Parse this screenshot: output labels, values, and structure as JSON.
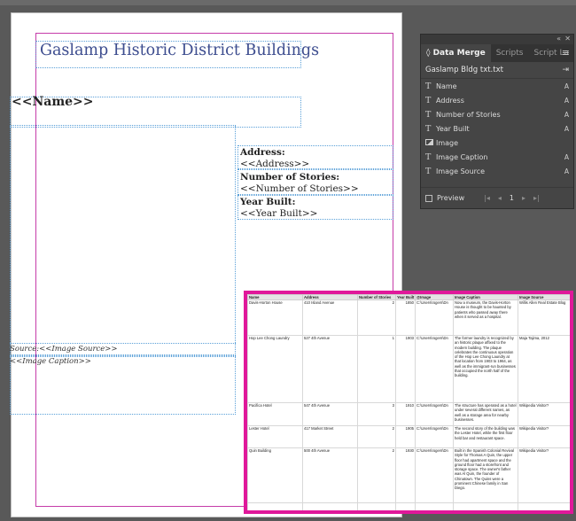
{
  "layout_page": {
    "title": "Gaslamp Historic District Buildings",
    "name_placeholder": "<<Name>>",
    "address_label": "Address:",
    "address_value": "<<Address>>",
    "stories_label": "Number of Stories:",
    "stories_value": "<<Number of Stories>>",
    "year_label": "Year Built:",
    "year_value": "<<Year Built>>",
    "source_text": "Source:<<Image Source>>",
    "caption_text": "<<Image Caption>>"
  },
  "panel": {
    "collapse_glyph": "«",
    "close_glyph": "✕",
    "tabs": [
      {
        "label": "◊ Data Merge"
      },
      {
        "label": "Scripts"
      },
      {
        "label": "Script La"
      }
    ],
    "menu_glyph": "≡",
    "source_file": "Gaslamp Bldg txt.txt",
    "fields": [
      {
        "label": "Name",
        "suffix": "A"
      },
      {
        "label": "Address",
        "suffix": "A"
      },
      {
        "label": "Number of Stories",
        "suffix": "A"
      },
      {
        "label": "Year Built",
        "suffix": "A"
      },
      {
        "label": "Image",
        "suffix": ""
      },
      {
        "label": "Image Caption",
        "suffix": "A"
      },
      {
        "label": "Image Source",
        "suffix": "A"
      }
    ],
    "preview_label": "Preview",
    "record_number": "1",
    "nav_first": "|◂",
    "nav_prev": "◂",
    "nav_next": "▸",
    "nav_last": "▸|"
  },
  "spreadsheet": {
    "headers": [
      "Name",
      "Address",
      "Number of Stories",
      "Year Built",
      "@Image",
      "Image Caption",
      "Image Source"
    ],
    "rows": [
      [
        "Davis-Horton House",
        "410 Island Avenue",
        "2",
        "1850",
        "C:\\Users\\rogers\\Dn",
        "Now a museum, the Davis-Horton House is thought to be haunted by patients who passed away there when it served as a hospital.",
        "Willis Allen Real Estate Blog"
      ],
      [
        "Hop Lee Chong Laundry",
        "527 4th Avenue",
        "1",
        "1903",
        "C:\\Users\\rogers\\Dn",
        "The former laundry is recognized by an historic plaque affixed to the modern building. The plaque celebrates the continuous operation of the Hop Lee Chong Laundry at that location from 1903 to 1964, as well as the immigrant-run businesses that occupied the north half of the building.",
        "Maja Tajima, 2012"
      ],
      [
        "Pacifica Hotel",
        "547 4th Avenue",
        "3",
        "1910",
        "C:\\Users\\rogers\\Dn",
        "The structure has operated as a hotel under several different names, as well as a storage area for nearby businesses.",
        "Wikipedia Visitor?"
      ],
      [
        "Lester Hotel",
        "417 Market Street",
        "2",
        "1905",
        "C:\\Users\\rogers\\Dn",
        "The second story of the building was the Lester Hotel, while the first floor held bar and restaurant space.",
        "Wikipedia Visitor?"
      ],
      [
        "Quin Building",
        "500 4th Avenue",
        "2",
        "1930",
        "C:\\Users\\rogers\\Dn",
        "Built in the Spanish Colonial Revival Style for Thomas A Quin, the upper floor had apartment space and the ground floor had a storefront and storage space. The owner's father was Al Quin, the founder of Chinatown. The Quins were a prominent Chinese family in San Diego.",
        "Wikipedia Visitor?"
      ]
    ]
  }
}
